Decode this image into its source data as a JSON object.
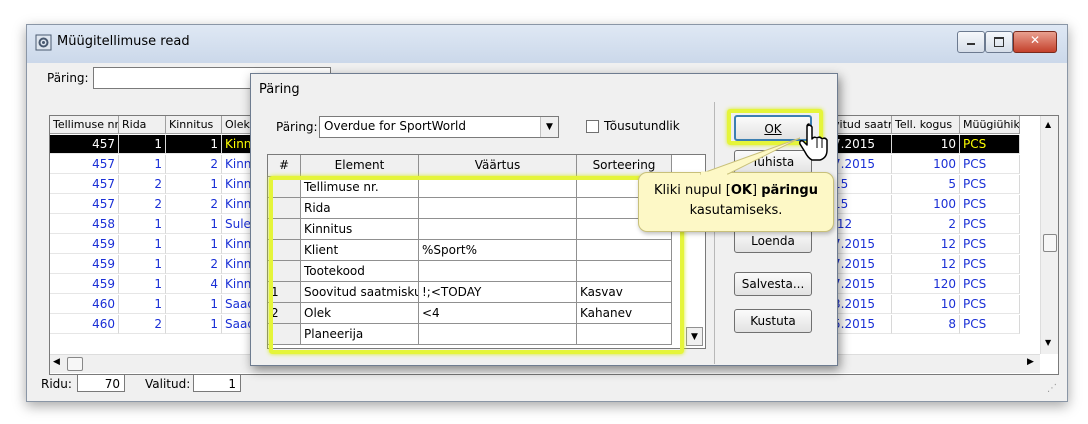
{
  "window": {
    "title": "Müügitellimuse read"
  },
  "query_bar": {
    "label": "Päring:",
    "value": ""
  },
  "grid": {
    "left_headers": [
      "Tellimuse nr.",
      "Rida",
      "Kinnitus",
      "Olek"
    ],
    "right_headers": [
      "vitud saatm",
      "Tell. kogus",
      "Müügiühik"
    ],
    "left_rows": [
      [
        "457",
        "1",
        "1",
        "Kinn"
      ],
      [
        "457",
        "1",
        "2",
        "Kinn"
      ],
      [
        "457",
        "2",
        "1",
        "Kinn"
      ],
      [
        "457",
        "2",
        "2",
        "Kinn"
      ],
      [
        "458",
        "1",
        "1",
        "Sule"
      ],
      [
        "459",
        "1",
        "1",
        "Kinn"
      ],
      [
        "459",
        "1",
        "2",
        "Kinn"
      ],
      [
        "459",
        "1",
        "4",
        "Kinn"
      ],
      [
        "460",
        "1",
        "1",
        "Saad"
      ],
      [
        "460",
        "2",
        "1",
        "Saad"
      ]
    ],
    "right_rows": [
      [
        "7.2015",
        "10",
        "PCS"
      ],
      [
        "7.2015",
        "100",
        "PCS"
      ],
      [
        "15",
        "5",
        "PCS"
      ],
      [
        "15",
        "100",
        "PCS"
      ],
      [
        ".12",
        "2",
        "PCS"
      ],
      [
        "7.2015",
        "12",
        "PCS"
      ],
      [
        "7.2015",
        "12",
        "PCS"
      ],
      [
        "7.2015",
        "120",
        "PCS"
      ],
      [
        "3.2015",
        "10",
        "PCS"
      ],
      [
        "5.2015",
        "8",
        "PCS"
      ]
    ],
    "selected_row": 0
  },
  "status": {
    "rows_label": "Ridu:",
    "rows_value": "70",
    "selected_label": "Valitud:",
    "selected_value": "1"
  },
  "dialog": {
    "title": "Päring",
    "query_label": "Päring:",
    "query_value": "Overdue for SportWorld",
    "ascending_label": "Tõusutundlik",
    "table_headers": [
      "#",
      "Element",
      "Väärtus",
      "Sorteering"
    ],
    "rows": [
      [
        "",
        "Tellimuse nr.",
        "",
        ""
      ],
      [
        "",
        "Rida",
        "",
        ""
      ],
      [
        "",
        "Kinnitus",
        "",
        ""
      ],
      [
        "",
        "Klient",
        "%Sport%",
        ""
      ],
      [
        "",
        "Tootekood",
        "",
        ""
      ],
      [
        "1",
        "Soovitud saatmiskuu",
        "!;<TODAY",
        "Kasvav"
      ],
      [
        "2",
        "Olek",
        "<4",
        "Kahanev"
      ],
      [
        "",
        "Planeerija",
        "",
        ""
      ]
    ],
    "buttons": {
      "ok": "OK",
      "cancel": "Tühista",
      "load": "Loenda",
      "save": "Salvesta...",
      "delete": "Kustuta"
    }
  },
  "callout": {
    "line1_pre": "Kliki nupul [",
    "line1_ok": "OK",
    "line1_mid": "] ",
    "line1_bold": "päringu",
    "line2": "kasutamiseks."
  },
  "colors": {
    "highlight": "#e5f53a",
    "selection": "#000000",
    "link_text": "#1a2fd6"
  }
}
